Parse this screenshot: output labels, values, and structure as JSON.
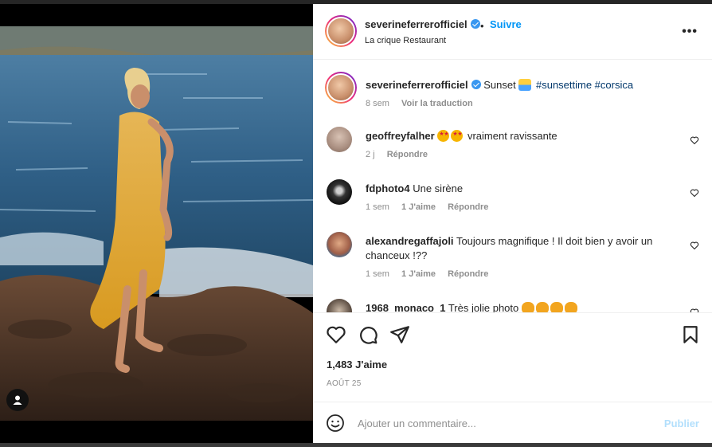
{
  "post": {
    "username": "severineferrerofficiel",
    "follow_label": "Suivre",
    "separator": "•",
    "location": "La crique Restaurant",
    "more_label": "•••"
  },
  "caption": {
    "username": "severineferrerofficiel",
    "text": "Sunset",
    "hashtags": "#sunsettime #corsica",
    "time": "8 sem",
    "translate": "Voir la traduction"
  },
  "comments": [
    {
      "username": "geoffreyfalher",
      "text": "vraiment ravissante",
      "time": "2 j",
      "likes": "",
      "reply": "Répondre"
    },
    {
      "username": "fdphoto4",
      "text": "Une sirène",
      "time": "1 sem",
      "likes": "1 J'aime",
      "reply": "Répondre"
    },
    {
      "username": "alexandregaffajoli",
      "text": "Toujours magnifique ! Il doit bien y avoir un chanceux !??",
      "time": "1 sem",
      "likes": "1 J'aime",
      "reply": "Répondre"
    },
    {
      "username": "1968_monaco_1",
      "text": "Très jolie photo",
      "time": "",
      "likes": "",
      "reply": ""
    }
  ],
  "stats": {
    "likes": "1,483 J'aime",
    "date": "AOÛT 25"
  },
  "composer": {
    "placeholder": "Ajouter un commentaire...",
    "publish": "Publier"
  },
  "icons": {
    "like": "heart-icon",
    "comment": "comment-icon",
    "share": "paper-plane-icon",
    "save": "bookmark-icon",
    "emoji": "smiley-icon",
    "more": "more-options-icon",
    "user_tag": "user-icon"
  },
  "colors": {
    "link": "#0095f6",
    "verified": "#3897f0",
    "hashtag": "#00376b",
    "muted": "#8e8e8e",
    "publish_disabled": "#b2dffc"
  }
}
